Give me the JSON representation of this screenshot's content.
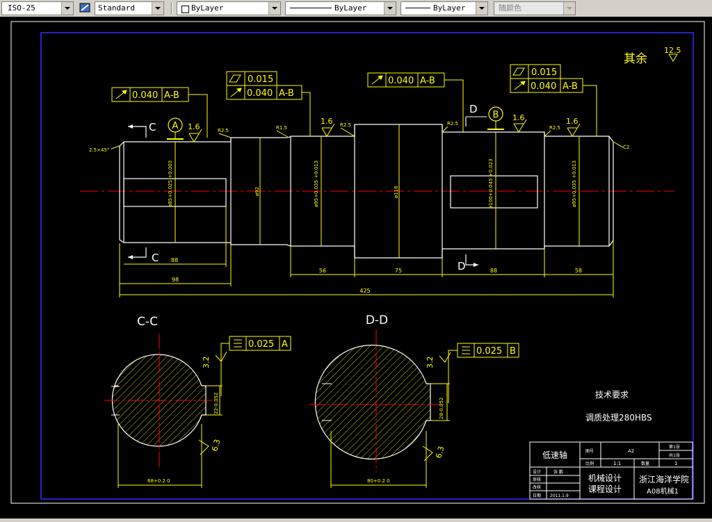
{
  "toolbar": {
    "dim_style": "ISO-25",
    "text_style": "Standard",
    "layer": "ByLayer",
    "linetype": "ByLayer",
    "lineweight": "ByLayer",
    "plot_style": "随颜色"
  },
  "drawing": {
    "finish_note_label": "其余",
    "finish_note_value": "12.5",
    "gdt": {
      "f1": "0.040",
      "f1_ref": "A-B",
      "f2_top": "0.015",
      "f2_bottom": "0.040",
      "f2_ref": "A-B",
      "f3": "0.040",
      "f3_ref": "A-B",
      "f4_top": "0.015",
      "f4_bottom": "0.040",
      "f4_ref": "A-B",
      "f5": "0.025",
      "f5_ref": "A",
      "f6": "0.025",
      "f6_ref": "B"
    },
    "datum": {
      "a": "A",
      "b": "B"
    },
    "section": {
      "c": "C",
      "d": "D",
      "cc_title": "C-C",
      "dd_title": "D-D"
    },
    "roughness": {
      "r16": "1.6",
      "r32": "3.2",
      "r63": "6.3"
    },
    "chamfers": {
      "left": "2.5×45°",
      "right": "C2"
    },
    "fillets": {
      "r1": "R2.5",
      "r2": "R1.5",
      "r3": "R2.5",
      "r4": "R2.5",
      "r5": "R2.5"
    },
    "diameters": {
      "d1": "ø85+0.025 +0.003",
      "d2": "ø92",
      "d3": "ø95+0.035 +0.013",
      "d4": "ø116",
      "d5": "ø100+0.045 +0.023",
      "d6": "ø95+0.035 +0.013"
    },
    "lengths": {
      "l88a": "88",
      "l98a": "98",
      "l56": "56",
      "l75": "75",
      "l88b": "88",
      "l58": "58",
      "l425": "425"
    },
    "section_dims": {
      "cc_width": "68+0.2 0",
      "cc_key": "22-0.052",
      "dd_width": "80+0.2 0",
      "dd_key": "28-0.052"
    },
    "tech_title": "技术要求",
    "tech_body": "调质处理280HBS"
  },
  "title_block": {
    "part_name": "低速轴",
    "drawing_no_label": "图号",
    "drawing_no": "A2",
    "sheet_label": "第1张",
    "sheets_label": "共1张",
    "scale_label": "比例",
    "scale": "1:1",
    "qty_label": "数量",
    "qty": "1",
    "design_label": "设计",
    "designer": "张 鹏",
    "check_label": "审核",
    "revise_label": "改核",
    "date_label": "日期",
    "date": "2011.1.9",
    "course": "机械设计",
    "course2": "课程设计",
    "school": "浙江海洋学院",
    "class": "A08机械1"
  }
}
